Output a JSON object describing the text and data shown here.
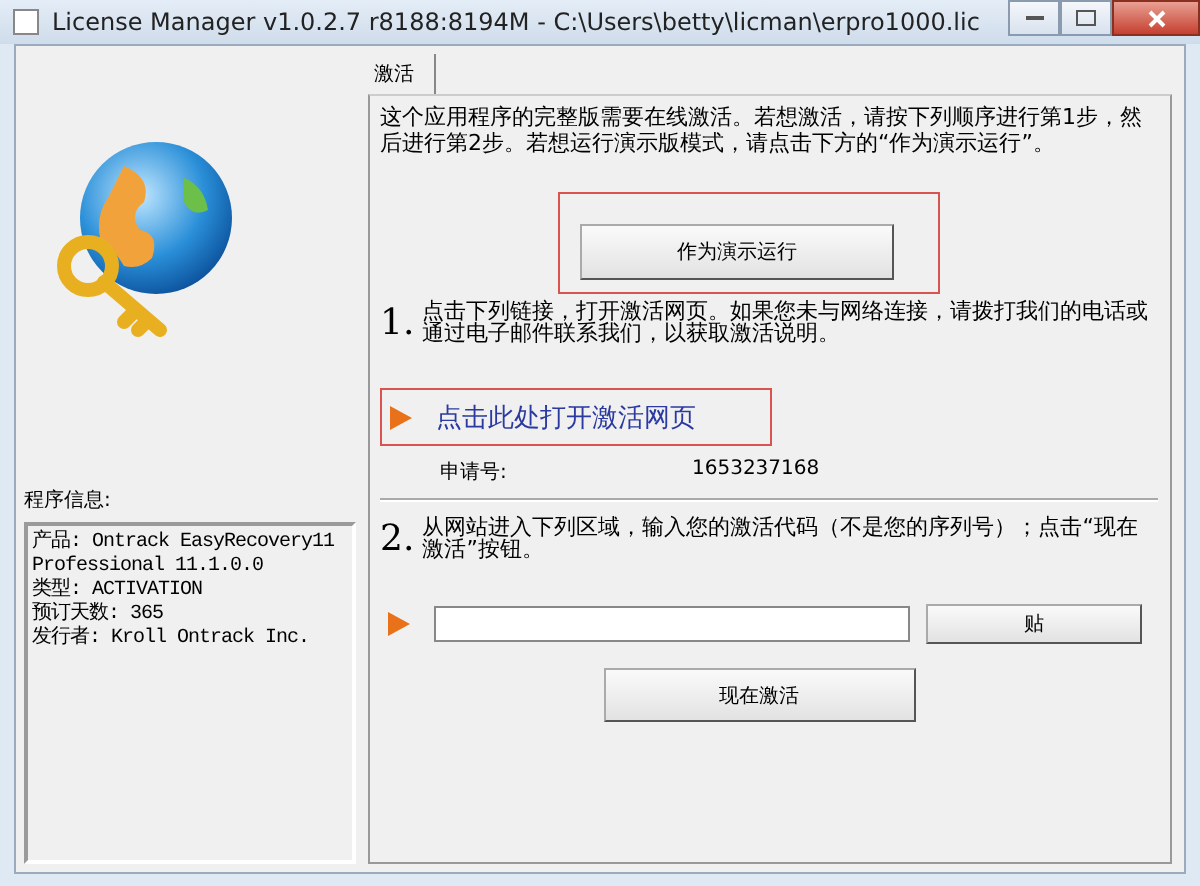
{
  "window": {
    "title": "License Manager v1.0.2.7 r8188:8194M - C:\\Users\\betty\\licman\\erpro1000.lic"
  },
  "program_info": {
    "label": "程序信息:",
    "lines": [
      "产品:  Ontrack EasyRecovery11",
      "Professional 11.1.0.0",
      "类型:  ACTIVATION",
      "预订天数:  365",
      "发行者:  Kroll Ontrack Inc."
    ]
  },
  "tabs": [
    {
      "label": "激活",
      "selected": true
    }
  ],
  "intro": "这个应用程序的完整版需要在线激活。若想激活，请按下列顺序进行第1步，然后进行第2步。若想运行演示版模式，请点击下方的“作为演示运行”。",
  "demo_button": "作为演示运行",
  "steps": [
    {
      "number": "1.",
      "text": "点击下列链接，打开激活网页。如果您未与网络连接，请拨打我们的电话或通过电子邮件联系我们，以获取激活说明。"
    },
    {
      "number": "2.",
      "text": "从网站进入下列区域，输入您的激活代码（不是您的序列号）；点击“现在激活”按钮。"
    }
  ],
  "activation_link": "点击此处打开激活网页",
  "request_number": {
    "label": "申请号:",
    "value": "1653237168"
  },
  "paste_button": "贴",
  "activate_button": "现在激活"
}
